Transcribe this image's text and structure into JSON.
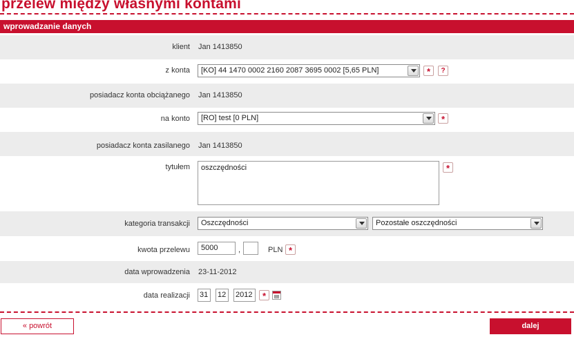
{
  "page": {
    "title": "przelew między własnymi kontami"
  },
  "section": {
    "header": "wprowadzanie danych"
  },
  "form": {
    "client": {
      "label": "klient",
      "value": "Jan 1413850"
    },
    "from_account": {
      "label": "z konta",
      "selected": "[KO] 44 1470 0002 2160 2087 3695 0002 [5,65 PLN]"
    },
    "debited_owner": {
      "label": "posiadacz konta obciążanego",
      "value": "Jan 1413850"
    },
    "to_account": {
      "label": "na konto",
      "selected": "[RO] test [0 PLN]"
    },
    "credited_owner": {
      "label": "posiadacz konta zasilanego",
      "value": "Jan 1413850"
    },
    "title": {
      "label": "tytułem",
      "value": "oszczędności"
    },
    "category": {
      "label": "kategoria transakcji",
      "main_selected": "Oszczędności",
      "sub_selected": "Pozostałe oszczędności"
    },
    "amount": {
      "label": "kwota przelewu",
      "whole": "5000",
      "separator": ",",
      "fraction": "",
      "currency": "PLN"
    },
    "entry_date": {
      "label": "data wprowadzenia",
      "value": "23-11-2012"
    },
    "execution_date": {
      "label": "data realizacji",
      "day": "31",
      "month": "12",
      "year": "2012"
    }
  },
  "icons": {
    "required": "*",
    "help": "?",
    "calendar": "calendar-icon"
  },
  "buttons": {
    "back": "« powrót",
    "next": "dalej"
  },
  "colors": {
    "accent": "#c8102e",
    "row_gray": "#ececec"
  }
}
